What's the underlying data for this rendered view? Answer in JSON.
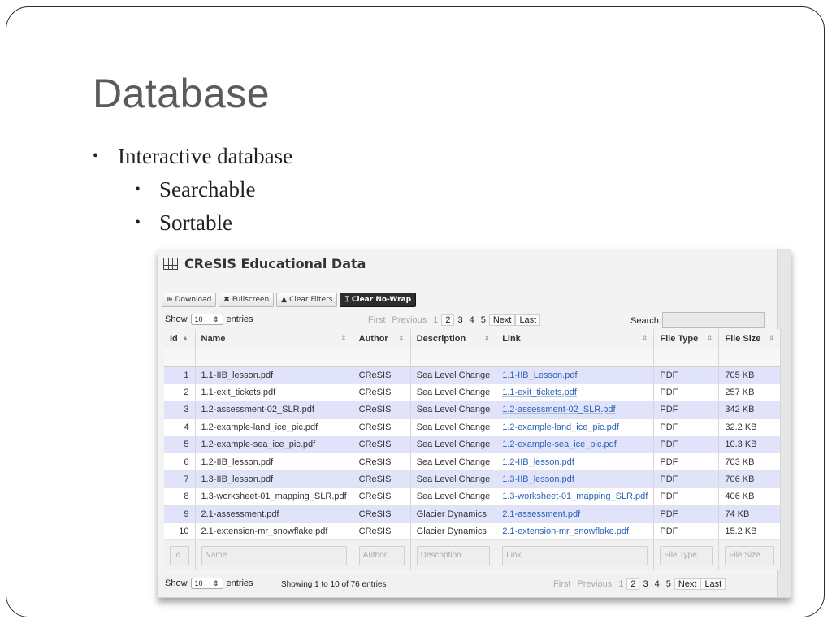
{
  "slide": {
    "title": "Database",
    "bullets": [
      "Interactive database",
      "Searchable",
      "Sortable"
    ]
  },
  "app": {
    "title": "CReSIS Educational Data",
    "icon": "table-icon",
    "toolbar": {
      "download": "Download",
      "fullscreen": "Fullscreen",
      "clear_filters": "Clear Filters",
      "clear_nowrap": "Clear No-Wrap"
    },
    "show_label": "Show",
    "entries_value": "10",
    "entries_label": "entries",
    "search_label": "Search:",
    "pager": {
      "first": "First",
      "previous": "Previous",
      "pages": [
        "1",
        "2",
        "3",
        "4",
        "5"
      ],
      "next": "Next",
      "last": "Last"
    },
    "columns": [
      "Id",
      "Name",
      "Author",
      "Description",
      "Link",
      "File Type",
      "File Size"
    ],
    "rows": [
      {
        "id": "1",
        "name": "1.1-IIB_lesson.pdf",
        "author": "CReSIS",
        "desc": "Sea Level Change",
        "link": "1.1-IIB_Lesson.pdf",
        "type": "PDF",
        "size": "705 KB"
      },
      {
        "id": "2",
        "name": "1.1-exit_tickets.pdf",
        "author": "CReSIS",
        "desc": "Sea Level Change",
        "link": "1.1-exit_tickets.pdf",
        "type": "PDF",
        "size": "257 KB"
      },
      {
        "id": "3",
        "name": "1.2-assessment-02_SLR.pdf",
        "author": "CReSIS",
        "desc": "Sea Level Change",
        "link": "1.2-assessment-02_SLR.pdf",
        "type": "PDF",
        "size": "342 KB"
      },
      {
        "id": "4",
        "name": "1.2-example-land_ice_pic.pdf",
        "author": "CReSIS",
        "desc": "Sea Level Change",
        "link": "1.2-example-land_ice_pic.pdf",
        "type": "PDF",
        "size": "32.2 KB"
      },
      {
        "id": "5",
        "name": "1.2-example-sea_ice_pic.pdf",
        "author": "CReSIS",
        "desc": "Sea Level Change",
        "link": "1.2-example-sea_ice_pic.pdf",
        "type": "PDF",
        "size": "10.3 KB"
      },
      {
        "id": "6",
        "name": "1.2-IIB_lesson.pdf",
        "author": "CReSIS",
        "desc": "Sea Level Change",
        "link": "1.2-IIB_lesson.pdf",
        "type": "PDF",
        "size": "703 KB"
      },
      {
        "id": "7",
        "name": "1.3-IIB_lesson.pdf",
        "author": "CReSIS",
        "desc": "Sea Level Change",
        "link": "1.3-IIB_lesson.pdf",
        "type": "PDF",
        "size": "706 KB"
      },
      {
        "id": "8",
        "name": "1.3-worksheet-01_mapping_SLR.pdf",
        "author": "CReSIS",
        "desc": "Sea Level Change",
        "link": "1.3-worksheet-01_mapping_SLR.pdf",
        "type": "PDF",
        "size": "406 KB"
      },
      {
        "id": "9",
        "name": "2.1-assessment.pdf",
        "author": "CReSIS",
        "desc": "Glacier Dynamics",
        "link": "2.1-assessment.pdf",
        "type": "PDF",
        "size": "74 KB"
      },
      {
        "id": "10",
        "name": "2.1-extension-mr_snowflake.pdf",
        "author": "CReSIS",
        "desc": "Glacier Dynamics",
        "link": "2.1-extension-mr_snowflake.pdf",
        "type": "PDF",
        "size": "15.2 KB"
      }
    ],
    "filter_placeholders": [
      "Id",
      "Name",
      "Author",
      "Description",
      "Link",
      "File Type",
      "File Size"
    ],
    "info_text": "Showing 1 to 10 of 76 entries"
  }
}
